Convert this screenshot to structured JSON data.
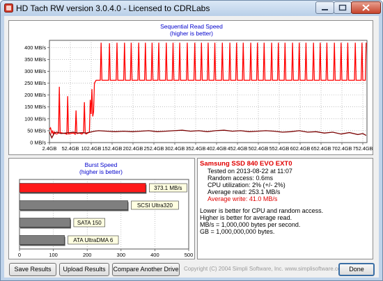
{
  "window": {
    "title": "HD Tach RW version 3.0.4.0 - Licensed to CDRLabs"
  },
  "seq_chart": {
    "title": "Sequential Read Speed",
    "subtitle": "(higher is better)",
    "y_ticks": [
      "0 MB/s",
      "50 MB/s",
      "100 MB/s",
      "150 MB/s",
      "200 MB/s",
      "250 MB/s",
      "300 MB/s",
      "350 MB/s",
      "400 MB/s"
    ],
    "x_ticks": [
      "2.4GB",
      "52.4GB",
      "102.4GB",
      "152.4GB",
      "202.4GB",
      "252.4GB",
      "302.4GB",
      "352.4GB",
      "402.4GB",
      "452.4GB",
      "502.4GB",
      "552.4GB",
      "602.4GB",
      "652.4GB",
      "702.4GB",
      "752.4GB"
    ]
  },
  "burst_chart": {
    "title": "Burst Speed",
    "subtitle": "(higher is better)",
    "x_ticks": [
      "0",
      "100",
      "200",
      "300",
      "400",
      "500"
    ],
    "bars": [
      {
        "label": "373.1 MB/s",
        "value": 373.1,
        "color": "#ff1a1a"
      },
      {
        "label": "SCSI Ultra320",
        "value": 320,
        "color": "#7f7f7f"
      },
      {
        "label": "SATA 150",
        "value": 150,
        "color": "#7f7f7f"
      },
      {
        "label": "ATA UltraDMA 6",
        "value": 133,
        "color": "#7f7f7f"
      }
    ]
  },
  "results": {
    "drive": "Samsung SSD 840 EVO EXT0",
    "tested": "Tested on 2013-08-22 at 11:07",
    "random_access": "Random access: 0.6ms",
    "cpu": "CPU utilization: 2% (+/- 2%)",
    "avg_read": "Average read: 253.1 MB/s",
    "avg_write": "Average write: 41.0 MB/s",
    "notes": [
      "Lower is better for CPU and random access.",
      "Higher is better for average read.",
      "MB/s = 1,000,000 bytes per second.",
      "GB = 1,000,000,000 bytes."
    ]
  },
  "buttons": {
    "save": "Save Results",
    "upload": "Upload Results",
    "compare": "Compare Another Drive",
    "done": "Done"
  },
  "footer": {
    "copyright": "Copyright (C) 2004 Simpli Software, Inc. www.simplisoftware.com"
  },
  "chart_data": [
    {
      "type": "line",
      "title": "Sequential Read Speed",
      "subtitle": "(higher is better)",
      "xlabel": "",
      "ylabel": "",
      "x_unit": "GB",
      "y_unit": "MB/s",
      "xlim": [
        2.4,
        762
      ],
      "ylim": [
        0,
        430
      ],
      "grid": true,
      "series": [
        {
          "color": "#ff0000",
          "points": [
            [
              2.4,
              55
            ],
            [
              5,
              62
            ],
            [
              8,
              40
            ],
            [
              10,
              48
            ],
            [
              12,
              35
            ],
            [
              14,
              45
            ],
            [
              16,
              38
            ],
            [
              20,
              36
            ],
            [
              24,
              40
            ],
            [
              26,
              235
            ],
            [
              28,
              42
            ],
            [
              34,
              40
            ],
            [
              40,
              38
            ],
            [
              44,
              35
            ],
            [
              46,
              195
            ],
            [
              48,
              36
            ],
            [
              52,
              38
            ],
            [
              60,
              40
            ],
            [
              64,
              35
            ],
            [
              66,
              135
            ],
            [
              68,
              38
            ],
            [
              74,
              40
            ],
            [
              80,
              36
            ],
            [
              84,
              42
            ],
            [
              86,
              170
            ],
            [
              88,
              40
            ],
            [
              90,
              36
            ],
            [
              94,
              40
            ],
            [
              98,
              45
            ],
            [
              100,
              180
            ],
            [
              102,
              120
            ],
            [
              104,
              225
            ],
            [
              106,
              110
            ],
            [
              108,
              130
            ],
            [
              110,
              250
            ],
            [
              114,
              262
            ],
            [
              120,
              262
            ],
            [
              124,
              262
            ],
            [
              126,
              420
            ],
            [
              128,
              262
            ],
            [
              140,
              262
            ],
            [
              144,
              262
            ],
            [
              146,
              418
            ],
            [
              148,
              262
            ],
            [
              160,
              262
            ],
            [
              162,
              262
            ],
            [
              164,
              420
            ],
            [
              166,
              262
            ],
            [
              178,
              262
            ],
            [
              180,
              262
            ],
            [
              182,
              420
            ],
            [
              184,
              262
            ],
            [
              194,
              262
            ],
            [
              196,
              262
            ],
            [
              198,
              420
            ],
            [
              200,
              262
            ],
            [
              212,
              262
            ],
            [
              214,
              262
            ],
            [
              216,
              420
            ],
            [
              218,
              262
            ],
            [
              228,
              262
            ],
            [
              230,
              262
            ],
            [
              232,
              420
            ],
            [
              234,
              262
            ],
            [
              244,
              262
            ],
            [
              246,
              262
            ],
            [
              248,
              420
            ],
            [
              250,
              262
            ],
            [
              260,
              262
            ],
            [
              262,
              262
            ],
            [
              264,
              420
            ],
            [
              266,
              262
            ],
            [
              278,
              262
            ],
            [
              280,
              262
            ],
            [
              282,
              420
            ],
            [
              284,
              262
            ],
            [
              294,
              262
            ],
            [
              296,
              262
            ],
            [
              298,
              420
            ],
            [
              300,
              262
            ],
            [
              310,
              262
            ],
            [
              312,
              262
            ],
            [
              314,
              420
            ],
            [
              316,
              262
            ],
            [
              328,
              262
            ],
            [
              330,
              262
            ],
            [
              332,
              420
            ],
            [
              334,
              262
            ],
            [
              346,
              262
            ],
            [
              348,
              262
            ],
            [
              350,
              420
            ],
            [
              352,
              262
            ],
            [
              362,
              262
            ],
            [
              364,
              262
            ],
            [
              366,
              420
            ],
            [
              368,
              262
            ],
            [
              378,
              262
            ],
            [
              380,
              262
            ],
            [
              382,
              420
            ],
            [
              384,
              262
            ],
            [
              394,
              262
            ],
            [
              396,
              262
            ],
            [
              398,
              420
            ],
            [
              400,
              262
            ],
            [
              412,
              262
            ],
            [
              414,
              262
            ],
            [
              416,
              420
            ],
            [
              418,
              262
            ],
            [
              430,
              262
            ],
            [
              432,
              262
            ],
            [
              434,
              420
            ],
            [
              436,
              262
            ],
            [
              446,
              262
            ],
            [
              448,
              262
            ],
            [
              450,
              420
            ],
            [
              452,
              262
            ],
            [
              462,
              262
            ],
            [
              464,
              262
            ],
            [
              466,
              420
            ],
            [
              468,
              262
            ],
            [
              480,
              262
            ],
            [
              482,
              262
            ],
            [
              484,
              420
            ],
            [
              486,
              262
            ],
            [
              496,
              262
            ],
            [
              498,
              262
            ],
            [
              500,
              420
            ],
            [
              502,
              262
            ],
            [
              512,
              262
            ],
            [
              514,
              262
            ],
            [
              516,
              420
            ],
            [
              518,
              262
            ],
            [
              530,
              262
            ],
            [
              532,
              262
            ],
            [
              534,
              420
            ],
            [
              536,
              262
            ],
            [
              546,
              262
            ],
            [
              548,
              262
            ],
            [
              550,
              420
            ],
            [
              552,
              262
            ],
            [
              562,
              262
            ],
            [
              564,
              262
            ],
            [
              566,
              420
            ],
            [
              568,
              262
            ],
            [
              580,
              262
            ],
            [
              582,
              262
            ],
            [
              584,
              420
            ],
            [
              586,
              262
            ],
            [
              596,
              262
            ],
            [
              598,
              262
            ],
            [
              600,
              420
            ],
            [
              602,
              262
            ],
            [
              612,
              262
            ],
            [
              614,
              262
            ],
            [
              616,
              420
            ],
            [
              618,
              262
            ],
            [
              630,
              262
            ],
            [
              632,
              262
            ],
            [
              634,
              420
            ],
            [
              636,
              262
            ],
            [
              646,
              262
            ],
            [
              648,
              262
            ],
            [
              650,
              420
            ],
            [
              652,
              262
            ],
            [
              662,
              262
            ],
            [
              664,
              262
            ],
            [
              666,
              420
            ],
            [
              668,
              262
            ],
            [
              680,
              262
            ],
            [
              682,
              262
            ],
            [
              684,
              420
            ],
            [
              686,
              262
            ],
            [
              696,
              262
            ],
            [
              698,
              262
            ],
            [
              700,
              420
            ],
            [
              702,
              262
            ],
            [
              712,
              262
            ],
            [
              714,
              262
            ],
            [
              716,
              420
            ],
            [
              718,
              262
            ],
            [
              730,
              262
            ],
            [
              732,
              262
            ],
            [
              734,
              420
            ],
            [
              736,
              262
            ],
            [
              746,
              262
            ],
            [
              748,
              262
            ],
            [
              750,
              420
            ],
            [
              752,
              262
            ],
            [
              758,
              262
            ],
            [
              760,
              420
            ]
          ]
        },
        {
          "color": "#7a0000",
          "points": [
            [
              2.4,
              45
            ],
            [
              8,
              20
            ],
            [
              14,
              40
            ],
            [
              20,
              44
            ],
            [
              30,
              38
            ],
            [
              40,
              40
            ],
            [
              50,
              42
            ],
            [
              60,
              44
            ],
            [
              70,
              40
            ],
            [
              80,
              42
            ],
            [
              90,
              40
            ],
            [
              100,
              44
            ],
            [
              110,
              48
            ],
            [
              120,
              50
            ],
            [
              140,
              48
            ],
            [
              160,
              46
            ],
            [
              180,
              48
            ],
            [
              200,
              46
            ],
            [
              220,
              48
            ],
            [
              240,
              50
            ],
            [
              260,
              46
            ],
            [
              280,
              48
            ],
            [
              300,
              50
            ],
            [
              320,
              52
            ],
            [
              340,
              48
            ],
            [
              360,
              50
            ],
            [
              380,
              46
            ],
            [
              400,
              50
            ],
            [
              420,
              52
            ],
            [
              440,
              48
            ],
            [
              460,
              50
            ],
            [
              480,
              46
            ],
            [
              500,
              48
            ],
            [
              520,
              50
            ],
            [
              540,
              48
            ],
            [
              560,
              44
            ],
            [
              580,
              46
            ],
            [
              600,
              50
            ],
            [
              620,
              44
            ],
            [
              640,
              46
            ],
            [
              660,
              40
            ],
            [
              680,
              44
            ],
            [
              700,
              36
            ],
            [
              720,
              42
            ],
            [
              740,
              34
            ],
            [
              752,
              38
            ],
            [
              760,
              30
            ]
          ]
        }
      ]
    },
    {
      "type": "bar",
      "orientation": "horizontal",
      "title": "Burst Speed",
      "subtitle": "(higher is better)",
      "categories": [
        "373.1 MB/s",
        "SCSI Ultra320",
        "SATA 150",
        "ATA UltraDMA 6"
      ],
      "values": [
        373.1,
        320,
        150,
        133
      ],
      "xlim": [
        0,
        500
      ],
      "x_ticks": [
        0,
        100,
        200,
        300,
        400,
        500
      ],
      "grid": true
    }
  ]
}
